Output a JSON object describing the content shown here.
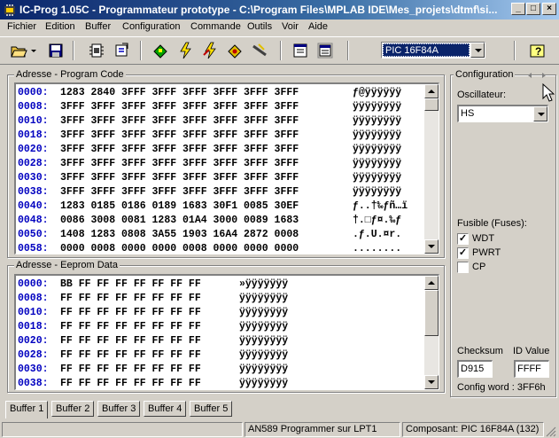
{
  "window": {
    "title": "IC-Prog 1.05C - Programmateur prototype - C:\\Program Files\\MPLAB IDE\\Mes_projets\\dtmf\\si...",
    "minimize": "_",
    "maximize": "□",
    "close": "×"
  },
  "menu": [
    "Fichier",
    "Edition",
    "Buffer",
    "Configuration",
    "Commande",
    "Outils",
    "Voir",
    "Aide"
  ],
  "toolbar": {
    "device": "PIC 16F84A",
    "icons": [
      "open-folder-icon",
      "dropdown-arrow-icon",
      "save-disk-icon",
      "chip-icon",
      "chip-config-icon",
      "read-device-icon",
      "program-device-icon",
      "erase-device-icon",
      "verify-device-icon",
      "blank-check-icon",
      "view-window-icon",
      "view-window-2-icon",
      "help-icon"
    ]
  },
  "program_code": {
    "title": "Adresse - Program Code",
    "rows": [
      {
        "addr": "0000:",
        "hex": "1283 2840 3FFF 3FFF 3FFF 3FFF 3FFF 3FFF",
        "ascii": "ƒ@ÿÿÿÿÿÿ"
      },
      {
        "addr": "0008:",
        "hex": "3FFF 3FFF 3FFF 3FFF 3FFF 3FFF 3FFF 3FFF",
        "ascii": "ÿÿÿÿÿÿÿÿ"
      },
      {
        "addr": "0010:",
        "hex": "3FFF 3FFF 3FFF 3FFF 3FFF 3FFF 3FFF 3FFF",
        "ascii": "ÿÿÿÿÿÿÿÿ"
      },
      {
        "addr": "0018:",
        "hex": "3FFF 3FFF 3FFF 3FFF 3FFF 3FFF 3FFF 3FFF",
        "ascii": "ÿÿÿÿÿÿÿÿ"
      },
      {
        "addr": "0020:",
        "hex": "3FFF 3FFF 3FFF 3FFF 3FFF 3FFF 3FFF 3FFF",
        "ascii": "ÿÿÿÿÿÿÿÿ"
      },
      {
        "addr": "0028:",
        "hex": "3FFF 3FFF 3FFF 3FFF 3FFF 3FFF 3FFF 3FFF",
        "ascii": "ÿÿÿÿÿÿÿÿ"
      },
      {
        "addr": "0030:",
        "hex": "3FFF 3FFF 3FFF 3FFF 3FFF 3FFF 3FFF 3FFF",
        "ascii": "ÿÿÿÿÿÿÿÿ"
      },
      {
        "addr": "0038:",
        "hex": "3FFF 3FFF 3FFF 3FFF 3FFF 3FFF 3FFF 3FFF",
        "ascii": "ÿÿÿÿÿÿÿÿ"
      },
      {
        "addr": "0040:",
        "hex": "1283 0185 0186 0189 1683 30F1 0085 30EF",
        "ascii": "ƒ..†‰ƒñ…ï"
      },
      {
        "addr": "0048:",
        "hex": "0086 3008 0081 1283 01A4 3000 0089 1683",
        "ascii": "†.□ƒ¤.‰ƒ"
      },
      {
        "addr": "0050:",
        "hex": "1408 1283 0808 3A55 1903 16A4 2872 0008",
        "ascii": ".ƒ.U.¤r."
      },
      {
        "addr": "0058:",
        "hex": "0000 0008 0000 0000 0008 0000 0000 0000",
        "ascii": "........"
      }
    ]
  },
  "eeprom": {
    "title": "Adresse - Eeprom Data",
    "rows": [
      {
        "addr": "0000:",
        "hex": "BB FF FF FF FF FF FF FF",
        "ascii": "»ÿÿÿÿÿÿÿ"
      },
      {
        "addr": "0008:",
        "hex": "FF FF FF FF FF FF FF FF",
        "ascii": "ÿÿÿÿÿÿÿÿ"
      },
      {
        "addr": "0010:",
        "hex": "FF FF FF FF FF FF FF FF",
        "ascii": "ÿÿÿÿÿÿÿÿ"
      },
      {
        "addr": "0018:",
        "hex": "FF FF FF FF FF FF FF FF",
        "ascii": "ÿÿÿÿÿÿÿÿ"
      },
      {
        "addr": "0020:",
        "hex": "FF FF FF FF FF FF FF FF",
        "ascii": "ÿÿÿÿÿÿÿÿ"
      },
      {
        "addr": "0028:",
        "hex": "FF FF FF FF FF FF FF FF",
        "ascii": "ÿÿÿÿÿÿÿÿ"
      },
      {
        "addr": "0030:",
        "hex": "FF FF FF FF FF FF FF FF",
        "ascii": "ÿÿÿÿÿÿÿÿ"
      },
      {
        "addr": "0038:",
        "hex": "FF FF FF FF FF FF FF FF",
        "ascii": "ÿÿÿÿÿÿÿÿ"
      }
    ]
  },
  "config": {
    "title": "Configuration",
    "osc_label": "Oscillateur:",
    "osc_value": "HS",
    "fuses_label": "Fusible (Fuses):",
    "fuses": [
      {
        "name": "WDT",
        "checked": true
      },
      {
        "name": "PWRT",
        "checked": true
      },
      {
        "name": "CP",
        "checked": false
      }
    ],
    "checksum_label": "Checksum",
    "checksum_value": "D915",
    "id_label": "ID Value",
    "id_value": "FFFF",
    "config_word": "Config word : 3FF6h"
  },
  "tabs": [
    "Buffer 1",
    "Buffer 2",
    "Buffer 3",
    "Buffer 4",
    "Buffer 5"
  ],
  "status": {
    "programmer": "AN589 Programmer sur LPT1",
    "component": "Composant: PIC 16F84A  (132)"
  },
  "colors": {
    "address": "#0000c0",
    "title_bar": "#0a246a",
    "face": "#d4d0c8"
  }
}
